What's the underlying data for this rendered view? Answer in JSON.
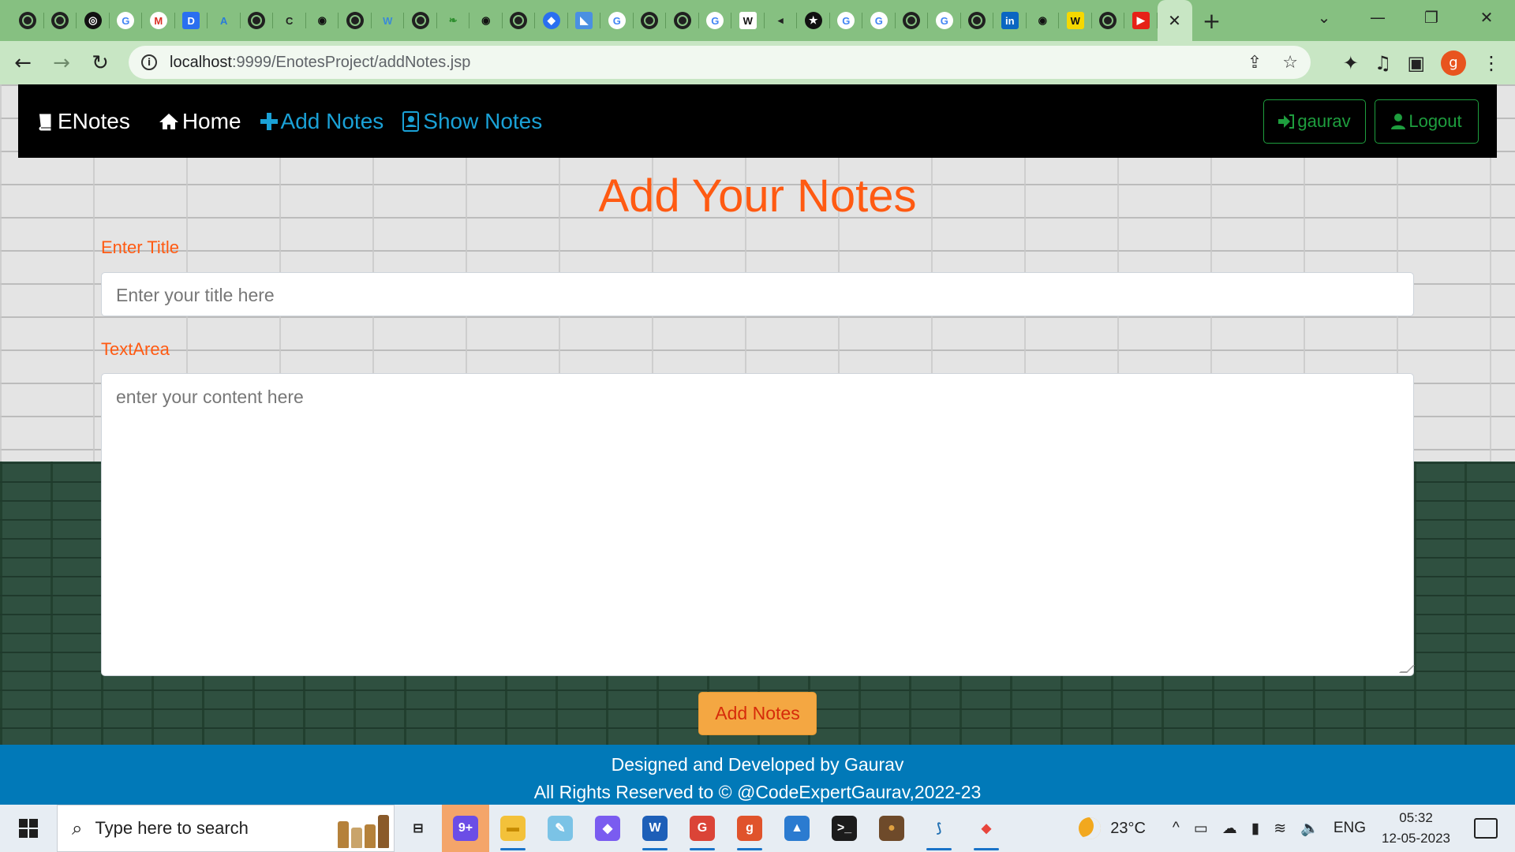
{
  "browser": {
    "tabs": [
      {
        "icon": "globe-icon",
        "letter": ""
      },
      {
        "icon": "globe-icon",
        "letter": ""
      },
      {
        "icon": "openai-icon",
        "letter": "◎"
      },
      {
        "icon": "google-icon",
        "letter": "G"
      },
      {
        "icon": "gmail-icon",
        "letter": "M"
      },
      {
        "icon": "docs-icon",
        "letter": "D"
      },
      {
        "icon": "triangle-icon",
        "letter": "A"
      },
      {
        "icon": "globe-icon",
        "letter": ""
      },
      {
        "icon": "codechef-icon",
        "letter": "C"
      },
      {
        "icon": "github-icon",
        "letter": "◉"
      },
      {
        "icon": "globe-icon",
        "letter": ""
      },
      {
        "icon": "w-icon",
        "letter": "W"
      },
      {
        "icon": "globe-icon",
        "letter": ""
      },
      {
        "icon": "leaf-icon",
        "letter": "❧"
      },
      {
        "icon": "github-icon",
        "letter": "◉"
      },
      {
        "icon": "globe-icon",
        "letter": ""
      },
      {
        "icon": "blue-diamond-icon",
        "letter": "◆"
      },
      {
        "icon": "azure-icon",
        "letter": "◣"
      },
      {
        "icon": "google-icon",
        "letter": "G"
      },
      {
        "icon": "globe-icon",
        "letter": ""
      },
      {
        "icon": "globe-icon",
        "letter": ""
      },
      {
        "icon": "google-icon",
        "letter": "G"
      },
      {
        "icon": "wikipedia-icon",
        "letter": "W"
      },
      {
        "icon": "mute-icon",
        "letter": "◂"
      },
      {
        "icon": "star-badge-icon",
        "letter": "★"
      },
      {
        "icon": "google-icon",
        "letter": "G"
      },
      {
        "icon": "google-icon",
        "letter": "G"
      },
      {
        "icon": "globe-icon",
        "letter": ""
      },
      {
        "icon": "google-icon",
        "letter": "G"
      },
      {
        "icon": "globe-icon",
        "letter": ""
      },
      {
        "icon": "linkedin-icon",
        "letter": "in"
      },
      {
        "icon": "github-icon",
        "letter": "◉"
      },
      {
        "icon": "w-yellow-icon",
        "letter": "W"
      },
      {
        "icon": "globe-icon",
        "letter": ""
      },
      {
        "icon": "youtube-icon",
        "letter": "▶"
      }
    ],
    "active_tab_close": "✕",
    "new_tab": "+",
    "tab_search": "⌄",
    "minimize": "—",
    "restore": "❐",
    "close": "✕",
    "back": "←",
    "forward": "→",
    "reload": "↻",
    "info": "i",
    "url_host": "localhost",
    "url_path": ":9999/EnotesProject/addNotes.jsp",
    "share": "⇪",
    "bookmark": "☆",
    "extensions": "✦",
    "media": "♫",
    "sidepanel": "▣",
    "profile_letter": "g",
    "menu": "⋮"
  },
  "navbar": {
    "brand": "ENotes",
    "brand_icon": "book-icon",
    "home": "Home",
    "add_notes": "Add Notes",
    "show_notes": "Show Notes",
    "user": "gaurav",
    "logout": "Logout"
  },
  "form": {
    "heading": "Add Your Notes",
    "title_label": "Enter Title",
    "title_placeholder": "Enter your title here",
    "content_label": "TextArea",
    "content_placeholder": "enter your content here",
    "submit": "Add Notes"
  },
  "footer": {
    "line1": "Designed and Developed by Gaurav",
    "line2": "All Rights Reserved to © @CodeExpertGaurav,2022-23"
  },
  "taskbar": {
    "search_placeholder": "Type here to search",
    "apps": [
      {
        "name": "task-view-icon",
        "letter": "⊟",
        "color": "#e7edf3",
        "fg": "#222",
        "running": false,
        "hl": false
      },
      {
        "name": "copilot-icon",
        "letter": "9+",
        "color": "#6b4de6",
        "fg": "#fff",
        "running": false,
        "hl": true
      },
      {
        "name": "file-explorer-icon",
        "letter": "▬",
        "color": "#f3c13a",
        "fg": "#c68a00",
        "running": true,
        "hl": false
      },
      {
        "name": "notepad-icon",
        "letter": "✎",
        "color": "#7bc3e6",
        "fg": "#fff",
        "running": false,
        "hl": false
      },
      {
        "name": "m365-icon",
        "letter": "◆",
        "color": "#7a5cf0",
        "fg": "#fff",
        "running": false,
        "hl": false
      },
      {
        "name": "word-icon",
        "letter": "W",
        "color": "#1d5fb8",
        "fg": "#fff",
        "running": true,
        "hl": false
      },
      {
        "name": "chrome-icon",
        "letter": "G",
        "color": "#db4437",
        "fg": "#fff",
        "running": true,
        "hl": false
      },
      {
        "name": "chrome-profile-icon",
        "letter": "g",
        "color": "#e0532b",
        "fg": "#fff",
        "running": true,
        "hl": false
      },
      {
        "name": "photos-icon",
        "letter": "▲",
        "color": "#2b7bd0",
        "fg": "#fff",
        "running": false,
        "hl": false
      },
      {
        "name": "terminal-icon",
        "letter": ">_",
        "color": "#1c1c1c",
        "fg": "#fff",
        "running": false,
        "hl": false
      },
      {
        "name": "app-badge-icon",
        "letter": "●",
        "color": "#6e4a2a",
        "fg": "#e0a040",
        "running": false,
        "hl": false
      },
      {
        "name": "mysql-icon",
        "letter": "⟆",
        "color": "#e7edf3",
        "fg": "#1f6fb2",
        "running": true,
        "hl": false
      },
      {
        "name": "git-icon",
        "letter": "◆",
        "color": "#e7edf3",
        "fg": "#e8453c",
        "running": true,
        "hl": false
      }
    ],
    "temperature": "23°C",
    "tray_chevron": "^",
    "language": "ENG",
    "time": "05:32",
    "date": "12-05-2023"
  }
}
